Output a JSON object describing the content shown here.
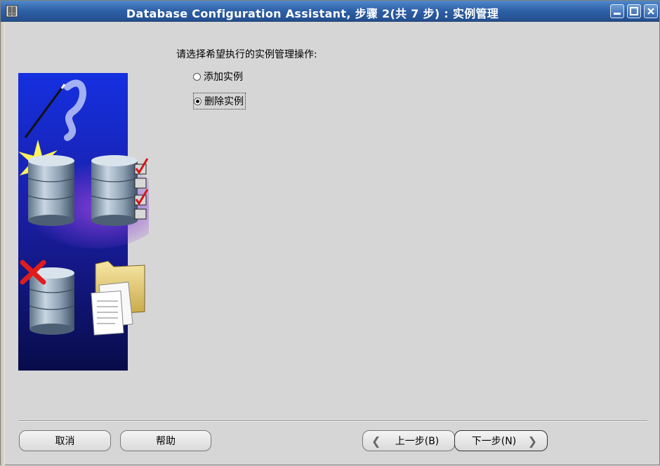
{
  "window": {
    "title": "Database Configuration Assistant, 步骤 2(共 7 步) : 实例管理"
  },
  "content": {
    "prompt": "请选择希望执行的实例管理操作:",
    "options": [
      {
        "label": "添加实例",
        "selected": false
      },
      {
        "label": "删除实例",
        "selected": true
      }
    ]
  },
  "buttons": {
    "cancel": "取消",
    "help": "帮助",
    "back": "上一步(B)",
    "next": "下一步(N)"
  },
  "colors": {
    "titlebar": "#2d5fa5",
    "background": "#d6d6d6",
    "panel_blue": "#0a1a8a"
  }
}
